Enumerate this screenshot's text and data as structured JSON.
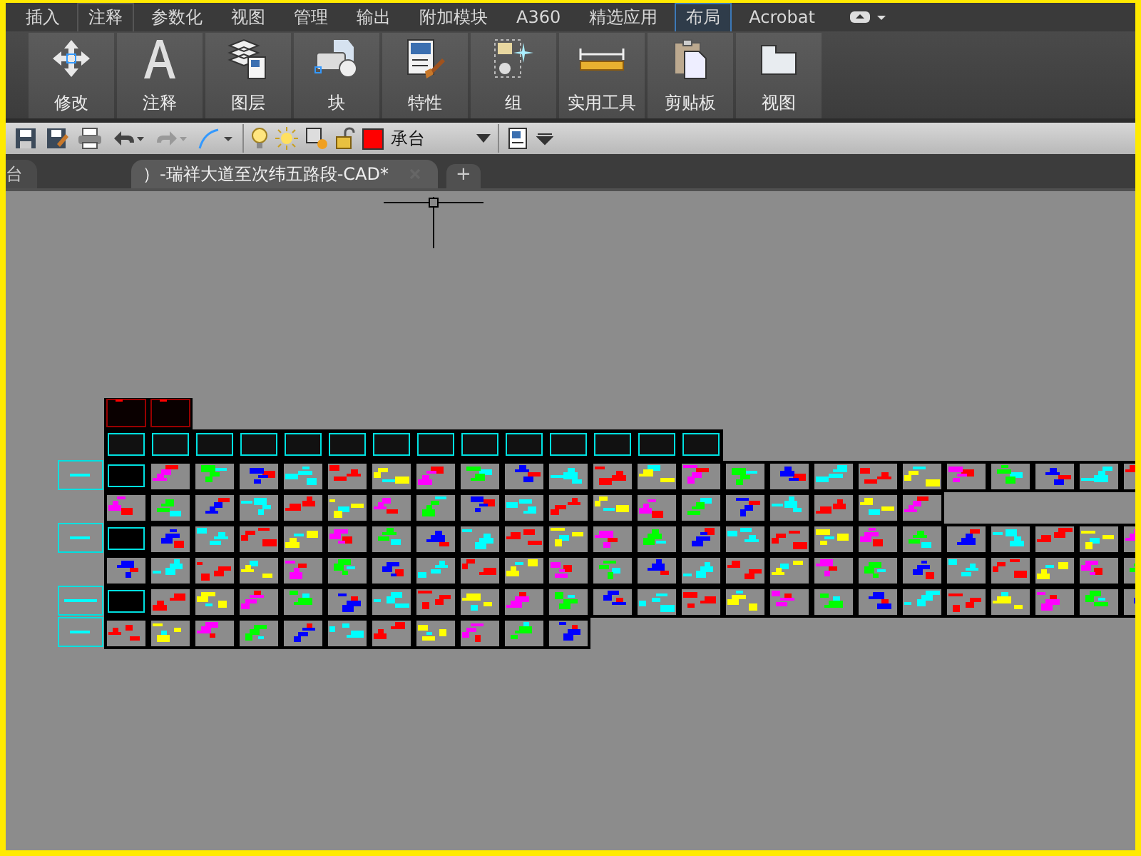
{
  "ribbon_tabs": [
    {
      "label": "插入",
      "selected": false,
      "hovered": false
    },
    {
      "label": "注释",
      "selected": false,
      "hovered": true
    },
    {
      "label": "参数化",
      "selected": false,
      "hovered": false
    },
    {
      "label": "视图",
      "selected": false,
      "hovered": false
    },
    {
      "label": "管理",
      "selected": false,
      "hovered": false
    },
    {
      "label": "输出",
      "selected": false,
      "hovered": false
    },
    {
      "label": "附加模块",
      "selected": false,
      "hovered": false
    },
    {
      "label": "A360",
      "selected": false,
      "hovered": false
    },
    {
      "label": "精选应用",
      "selected": false,
      "hovered": false
    },
    {
      "label": "布局",
      "selected": true,
      "hovered": false
    },
    {
      "label": "Acrobat",
      "selected": false,
      "hovered": false
    }
  ],
  "ribbon_panels": [
    {
      "label": "修改",
      "kind": "move"
    },
    {
      "label": "注释",
      "kind": "text"
    },
    {
      "label": "图层",
      "kind": "layers"
    },
    {
      "label": "块",
      "kind": "block"
    },
    {
      "label": "特性",
      "kind": "properties"
    },
    {
      "label": "组",
      "kind": "group"
    },
    {
      "label": "实用工具",
      "kind": "measure"
    },
    {
      "label": "剪贴板",
      "kind": "clipboard"
    },
    {
      "label": "视图",
      "kind": "view"
    }
  ],
  "layer": {
    "name": "承台",
    "color": "#ff0000"
  },
  "document_tabs": [
    {
      "label": "台",
      "selected": false,
      "closable": false
    },
    {
      "label": "）-瑞祥大道至次纬五路段-CAD*",
      "selected": true,
      "closable": true
    }
  ],
  "new_tab": "+"
}
